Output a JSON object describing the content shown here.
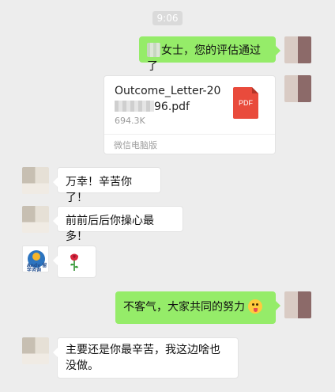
{
  "timestamp": "9:06",
  "messages": [
    {
      "side": "right",
      "text": "女士，您的评估通过了"
    },
    {
      "side": "right",
      "type": "file",
      "file_name_line1": "Outcome_Letter-20",
      "file_name_line2_suffix": "96.pdf",
      "file_size": "694.3K",
      "file_source": "微信电脑版",
      "file_badge": "PDF"
    },
    {
      "side": "left",
      "text": "万幸！辛苦你了！"
    },
    {
      "side": "left",
      "text": "前前后后你操心最多！"
    },
    {
      "side": "left",
      "type": "sticker",
      "sticker": "rose-icon"
    },
    {
      "side": "right",
      "text": "不客气，大家共同的努力"
    },
    {
      "side": "left",
      "text": "主要还是你最辛苦，我这边啥也没做。"
    }
  ],
  "andy_avatar_label": "Andy 留学咨询",
  "colors": {
    "background": "#EDEDED",
    "sent_bubble": "#95EC69",
    "received_bubble": "#FFFFFF",
    "pdf_icon": "#E94B3C"
  }
}
